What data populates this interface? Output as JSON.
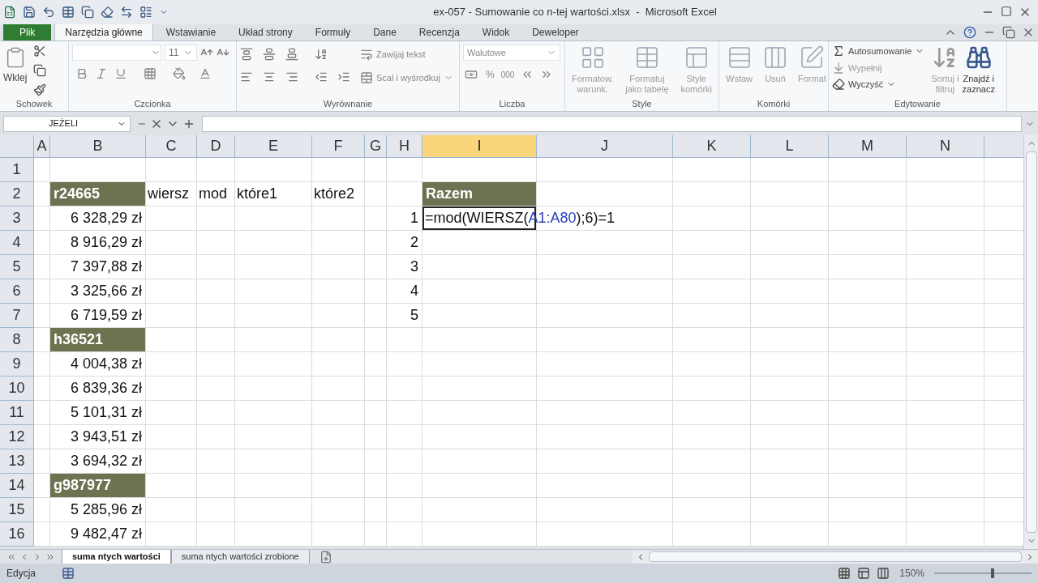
{
  "window": {
    "title": "ex-057 - Sumowanie co n-tej wartości.xlsx  -  Microsoft Excel"
  },
  "tabs": [
    {
      "label": "Plik",
      "kind": "file",
      "selected": false
    },
    {
      "label": "Narzędzia główne",
      "kind": "tab",
      "selected": true
    },
    {
      "label": "Wstawianie",
      "kind": "tab",
      "selected": false
    },
    {
      "label": "Układ strony",
      "kind": "tab",
      "selected": false
    },
    {
      "label": "Formuły",
      "kind": "tab",
      "selected": false
    },
    {
      "label": "Dane",
      "kind": "tab",
      "selected": false
    },
    {
      "label": "Recenzja",
      "kind": "tab",
      "selected": false
    },
    {
      "label": "Widok",
      "kind": "tab",
      "selected": false
    },
    {
      "label": "Deweloper",
      "kind": "tab",
      "selected": false
    }
  ],
  "ribbon": {
    "clipboard": {
      "title": "Schowek",
      "paste": "Wklej"
    },
    "font": {
      "title": "Czcionka",
      "size": "11"
    },
    "alignment": {
      "title": "Wyrównanie",
      "wrap": "Zawijaj tekst",
      "merge": "Scal i wyśrodkuj"
    },
    "number": {
      "title": "Liczba",
      "format": "Walutowe",
      "percent": "%",
      "thousands": "000"
    },
    "styles": {
      "title": "Style",
      "buttons": [
        {
          "label": "Formatow.\nwarunk.",
          "disabled": true
        },
        {
          "label": "Formatuj\njako tabelę",
          "disabled": true
        },
        {
          "label": "Style\nkomórki",
          "disabled": true
        }
      ]
    },
    "cells": {
      "title": "Komórki",
      "buttons": [
        {
          "label": "Wstaw",
          "disabled": true
        },
        {
          "label": "Usuń",
          "disabled": true
        },
        {
          "label": "Format",
          "disabled": true
        }
      ]
    },
    "editing": {
      "title": "Edytowanie",
      "autosum": "Autosumowanie",
      "fill": "Wypełnij",
      "clear": "Wyczyść",
      "sort": "Sortuj i\nfiltruj",
      "find": "Znajdź i\nzaznacz"
    }
  },
  "name_box": "JEŻELI",
  "columns": [
    {
      "label": "A",
      "selected": false
    },
    {
      "label": "B",
      "selected": false
    },
    {
      "label": "C",
      "selected": false
    },
    {
      "label": "D",
      "selected": false
    },
    {
      "label": "E",
      "selected": false
    },
    {
      "label": "F",
      "selected": false
    },
    {
      "label": "G",
      "selected": false
    },
    {
      "label": "H",
      "selected": false
    },
    {
      "label": "I",
      "selected": true
    },
    {
      "label": "J",
      "selected": false
    },
    {
      "label": "K",
      "selected": false
    },
    {
      "label": "L",
      "selected": false
    },
    {
      "label": "M",
      "selected": false
    },
    {
      "label": "N",
      "selected": false
    }
  ],
  "rows": [
    {
      "label": "1"
    },
    {
      "label": "2",
      "cells": [
        {},
        {
          "text": "r24665",
          "kind": "label"
        },
        {
          "text": "wiersz",
          "kind": "text"
        },
        {
          "text": "mod",
          "kind": "text"
        },
        {
          "text": "które1",
          "kind": "text"
        },
        {
          "text": "które2",
          "kind": "text"
        },
        {},
        {},
        {
          "text": "Razem",
          "kind": "label"
        }
      ]
    },
    {
      "label": "3",
      "cells": [
        {},
        {
          "text": "6 328,29 zł",
          "kind": "number"
        },
        {},
        {},
        {},
        {},
        {},
        {
          "text": "1",
          "kind": "number"
        },
        {
          "kind": "formula",
          "parts": [
            {
              "text": "=mod(WIERSZ(",
              "ref": false
            },
            {
              "text": "A1:A80",
              "ref": true
            },
            {
              "text": ");6)=1",
              "ref": false
            }
          ]
        }
      ]
    },
    {
      "label": "4",
      "cells": [
        {},
        {
          "text": "8 916,29 zł",
          "kind": "number"
        },
        {},
        {},
        {},
        {},
        {},
        {
          "text": "2",
          "kind": "number"
        }
      ]
    },
    {
      "label": "5",
      "cells": [
        {},
        {
          "text": "7 397,88 zł",
          "kind": "number"
        },
        {},
        {},
        {},
        {},
        {},
        {
          "text": "3",
          "kind": "number"
        }
      ]
    },
    {
      "label": "6",
      "cells": [
        {},
        {
          "text": "3 325,66 zł",
          "kind": "number"
        },
        {},
        {},
        {},
        {},
        {},
        {
          "text": "4",
          "kind": "number"
        }
      ]
    },
    {
      "label": "7",
      "cells": [
        {},
        {
          "text": "6 719,59 zł",
          "kind": "number"
        },
        {},
        {},
        {},
        {},
        {},
        {
          "text": "5",
          "kind": "number"
        }
      ]
    },
    {
      "label": "8",
      "cells": [
        {},
        {
          "text": "h36521",
          "kind": "label"
        }
      ]
    },
    {
      "label": "9",
      "cells": [
        {},
        {
          "text": "4 004,38 zł",
          "kind": "number"
        }
      ]
    },
    {
      "label": "10",
      "cells": [
        {},
        {
          "text": "6 839,36 zł",
          "kind": "number"
        }
      ]
    },
    {
      "label": "11",
      "cells": [
        {},
        {
          "text": "5 101,31 zł",
          "kind": "number"
        }
      ]
    },
    {
      "label": "12",
      "cells": [
        {},
        {
          "text": "3 943,51 zł",
          "kind": "number"
        }
      ]
    },
    {
      "label": "13",
      "cells": [
        {},
        {
          "text": "3 694,32 zł",
          "kind": "number"
        }
      ]
    },
    {
      "label": "14",
      "cells": [
        {},
        {
          "text": "g987977",
          "kind": "label"
        }
      ]
    },
    {
      "label": "15",
      "cells": [
        {},
        {
          "text": "5 285,96 zł",
          "kind": "number"
        }
      ]
    },
    {
      "label": "16",
      "cells": [
        {},
        {
          "text": "9 482,47 zł",
          "kind": "number"
        }
      ]
    }
  ],
  "sheets": [
    {
      "label": "suma ntych wartości",
      "selected": true
    },
    {
      "label": "suma ntych wartości zrobione",
      "selected": false
    }
  ],
  "status_bar": {
    "mode": "Edycja",
    "zoom": "150%",
    "zoom_slider": {
      "level": 0.6
    }
  }
}
